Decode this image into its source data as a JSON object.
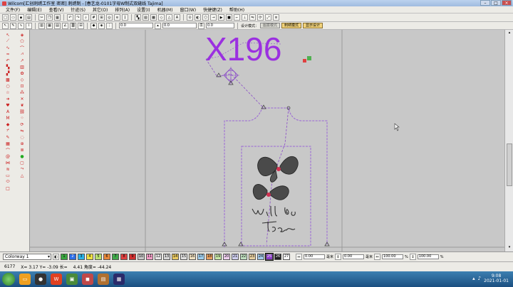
{
  "window": {
    "title": "Wilcom[汇创刺绣工作室  密密]  刺绣制 - [春艺龙-0101字母W制式双缝线      Tajima]"
  },
  "menu": [
    "文件(F)",
    "编辑(E)",
    "查看(V)",
    "针迹(S)",
    "其它(O)",
    "排列(A)",
    "设置(I)",
    "机器(M)",
    "窗口(W)",
    "快捷键(Z)",
    "帮助(H)"
  ],
  "toolbar2": {
    "field1": "0.0",
    "field2": "0.0",
    "field3": "0.0",
    "design_mode_label": "设计模式：",
    "mode_button_1": "图案模式",
    "mode_button_2": "刺绣模式",
    "mode_button_3": "显示设计"
  },
  "canvas": {
    "design_text": "X196",
    "accent_purple": "#9b30e0",
    "dash_purple": "#9a66d6"
  },
  "colorbar": {
    "colorway": "Colorway 1",
    "swatches": [
      {
        "n": "1",
        "c": "#3aa640"
      },
      {
        "n": "2",
        "c": "#2e6ee8"
      },
      {
        "n": "3",
        "c": "#2bb4e8"
      },
      {
        "n": "4",
        "c": "#f0e040"
      },
      {
        "n": "5",
        "c": "#b9e070"
      },
      {
        "n": "6",
        "c": "#e8883a"
      },
      {
        "n": "7",
        "c": "#40a84a"
      },
      {
        "n": "8",
        "c": "#e04040"
      },
      {
        "n": "9",
        "c": "#d03030"
      },
      {
        "n": "10",
        "c": "#c8c8c8"
      },
      {
        "n": "11",
        "c": "#f5a0c8"
      },
      {
        "n": "12",
        "c": "#e8e8e8"
      },
      {
        "n": "13",
        "c": "#d8d8d8"
      },
      {
        "n": "14",
        "c": "#e8c860"
      },
      {
        "n": "15",
        "c": "#e0e0e0"
      },
      {
        "n": "16",
        "c": "#f0e0c0"
      },
      {
        "n": "17",
        "c": "#a0d0f0"
      },
      {
        "n": "18",
        "c": "#e8a060"
      },
      {
        "n": "19",
        "c": "#c8e8a8"
      },
      {
        "n": "20",
        "c": "#f0d0f0"
      },
      {
        "n": "21",
        "c": "#d0d0f0"
      },
      {
        "n": "22",
        "c": "#c0e0c0"
      },
      {
        "n": "23",
        "c": "#e8d0a0"
      },
      {
        "n": "24",
        "c": "#a0c8e8"
      },
      {
        "n": "25",
        "c": "#8a3ac8"
      },
      {
        "n": "26",
        "c": "#202020"
      },
      {
        "n": "27",
        "c": "#ffffff"
      }
    ],
    "val1": "0.00",
    "val2": "0.00",
    "val3": "100.00",
    "val4": "100.00",
    "unit_pct": "%",
    "lbl_a": "毫米",
    "lbl_b": "毫米"
  },
  "status": {
    "stitches": "6177",
    "coords": "X=   3.17 Y=  -3.09 长=",
    "length": "4.41 角度= -44.24"
  },
  "taskbar": {
    "time": "9:08",
    "date": "2021-01-01"
  }
}
